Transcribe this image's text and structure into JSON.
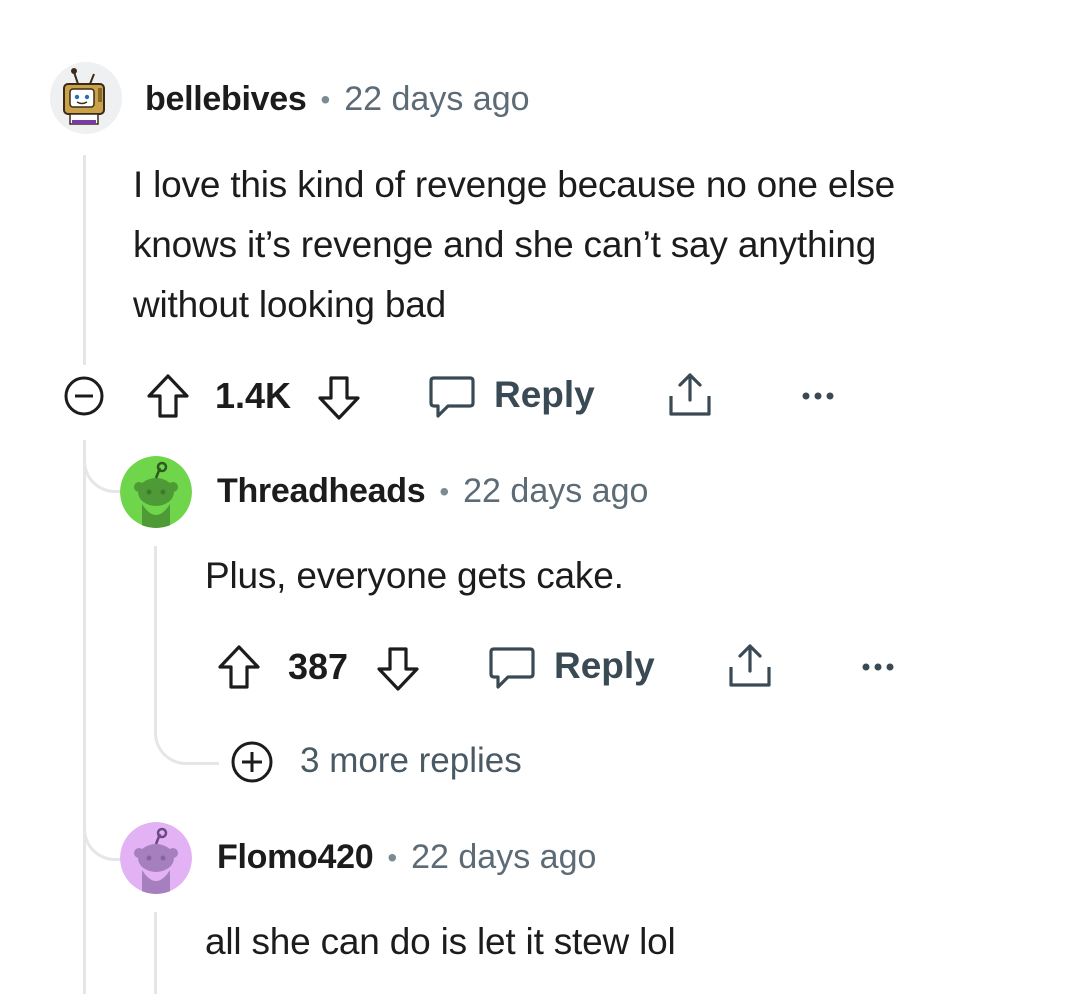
{
  "comments": [
    {
      "username": "bellebives",
      "time": "22 days ago",
      "body": [
        "I love this kind of revenge because no one else",
        "knows it’s revenge and she can’t say anything",
        "without looking bad"
      ],
      "score": "1.4K",
      "reply_label": "Reply"
    },
    {
      "username": "Threadheads",
      "time": "22 days ago",
      "body": [
        "Plus, everyone gets cake."
      ],
      "score": "387",
      "reply_label": "Reply",
      "more_replies": "3 more replies",
      "avatar_color": "#6fd54a"
    },
    {
      "username": "Flomo420",
      "time": "22 days ago",
      "body": [
        "all she can do is let it stew lol"
      ],
      "avatar_color": "#e2b2f5"
    }
  ],
  "separator": "•",
  "icons": [
    "collapse-icon",
    "upvote-icon",
    "downvote-icon",
    "reply-bubble-icon",
    "share-icon",
    "overflow-menu-icon",
    "expand-icon"
  ]
}
